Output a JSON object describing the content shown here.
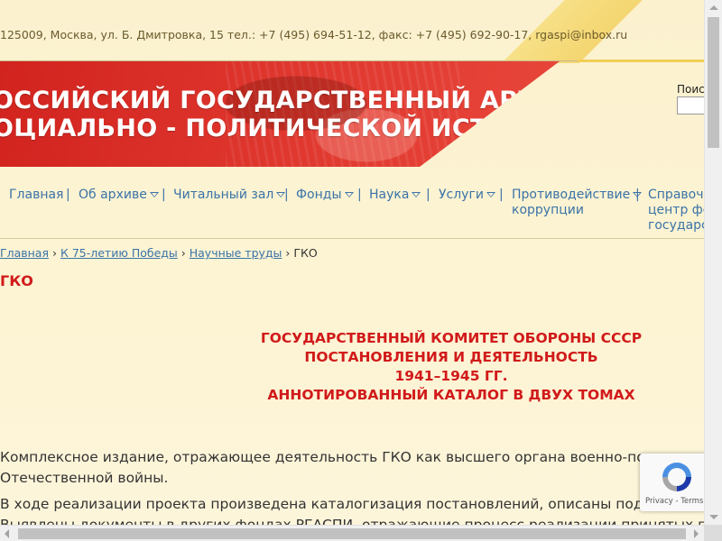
{
  "header": {
    "contact": "125009, Москва, ул. Б. Дмитровка, 15 тел.: +7 (495) 694-51-12, факс: +7 (495) 692-90-17, rgaspi@inbox.ru",
    "title_line1": "ОССИЙСКИЙ ГОСУДАРСТВЕННЫЙ АРХИВ",
    "title_line2": "ОЦИАЛЬНО - ПОЛИТИЧЕСКОЙ ИСТОРИИ",
    "search_label": "Поис"
  },
  "nav": {
    "items": [
      {
        "label": "Главная"
      },
      {
        "label": "Об архиве"
      },
      {
        "label": "Читальный зал"
      },
      {
        "label": "Фонды"
      },
      {
        "label": "Наука"
      },
      {
        "label": "Услуги"
      },
      {
        "label": "Противодействие",
        "label2": "коррупции"
      },
      {
        "label": "Справочн",
        "label2": "центр фе",
        "label3": "государст"
      }
    ],
    "separator": "|"
  },
  "breadcrumb": {
    "home": "Главная",
    "section": "К 75-летию Победы",
    "subsection": "Научные труды",
    "sep": "›",
    "current": "ГКО"
  },
  "content": {
    "page_title": "ГКО",
    "heading": [
      "ГОСУДАРСТВЕННЫЙ КОМИТЕТ ОБОРОНЫ СССР",
      "ПОСТАНОВЛЕНИЯ И ДЕЯТЕЛЬНОСТЬ",
      "1941–1945 ГГ.",
      "АННОТИРОВАННЫЙ КАТАЛОГ В ДВУХ ТОМАХ"
    ],
    "para1_line1": "Комплексное издание, отражающее деятельность ГКО как высшего органа военно-по",
    "para1_line2": "Отечественной войны.",
    "para2_line1": "В ходе реализации проекта произведена каталогизация постановлений, описаны подготов",
    "para2_line2": "Выявлены документы в других фондах РГАСПИ, отражающие процесс реализации принятых пос"
  },
  "recaptcha": {
    "links": "Privacy - Terms"
  },
  "colors": {
    "banner_red": "#d2231f",
    "title_red": "#d11a1a",
    "link_blue": "#3a73a8",
    "page_bg": "#fdf3cf"
  }
}
